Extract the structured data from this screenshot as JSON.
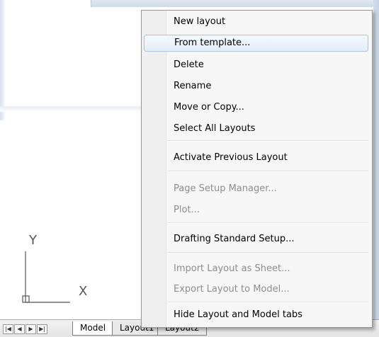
{
  "ucs": {
    "y_label": "Y",
    "x_label": "X"
  },
  "tabs": {
    "nav_first": "|◀",
    "nav_prev": "◀",
    "nav_next": "▶",
    "nav_last": "▶|",
    "items": [
      "Model",
      "Layout1",
      "Layout2"
    ]
  },
  "menu": {
    "items": [
      {
        "label": "New layout",
        "state": "enabled"
      },
      {
        "label": "From template...",
        "state": "hover"
      },
      {
        "label": "Delete",
        "state": "enabled"
      },
      {
        "label": "Rename",
        "state": "enabled"
      },
      {
        "label": "Move or Copy...",
        "state": "enabled"
      },
      {
        "label": "Select All Layouts",
        "state": "enabled"
      },
      {
        "label": "Activate Previous Layout",
        "state": "enabled"
      },
      {
        "label": "Page Setup Manager...",
        "state": "disabled"
      },
      {
        "label": "Plot...",
        "state": "disabled"
      },
      {
        "label": "Drafting Standard Setup...",
        "state": "enabled"
      },
      {
        "label": "Import Layout as Sheet...",
        "state": "disabled"
      },
      {
        "label": "Export Layout to Model...",
        "state": "disabled"
      },
      {
        "label": "Hide Layout and Model tabs",
        "state": "enabled"
      }
    ]
  },
  "colors": {
    "hover_border": "#a9c4e6",
    "disabled_text": "#8d8d8d"
  }
}
